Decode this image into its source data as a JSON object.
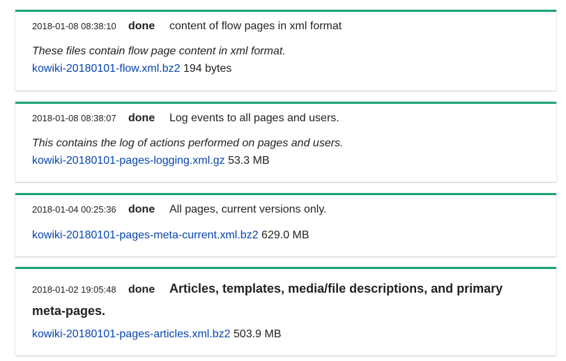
{
  "jobs": [
    {
      "timestamp": "2018-01-08 08:38:10",
      "status": "done",
      "title": "content of flow pages in xml format",
      "description": "These files contain flow page content in xml format.",
      "file_name": "kowiki-20180101-flow.xml.bz2",
      "file_size": "194 bytes"
    },
    {
      "timestamp": "2018-01-08 08:38:07",
      "status": "done",
      "title": "Log events to all pages and users.",
      "description": "This contains the log of actions performed on pages and users.",
      "file_name": "kowiki-20180101-pages-logging.xml.gz",
      "file_size": "53.3 MB"
    },
    {
      "timestamp": "2018-01-04 00:25:36",
      "status": "done",
      "title": "All pages, current versions only.",
      "file_name": "kowiki-20180101-pages-meta-current.xml.bz2",
      "file_size": "629.0 MB"
    },
    {
      "timestamp": "2018-01-02 19:05:48",
      "status": "done",
      "title": "Articles, templates, media/file descriptions, and primary meta-pages.",
      "file_name": "kowiki-20180101-pages-articles.xml.bz2",
      "file_size": "503.9 MB"
    }
  ],
  "colors": {
    "accent": "#1aa37a",
    "link": "#0645ad"
  }
}
